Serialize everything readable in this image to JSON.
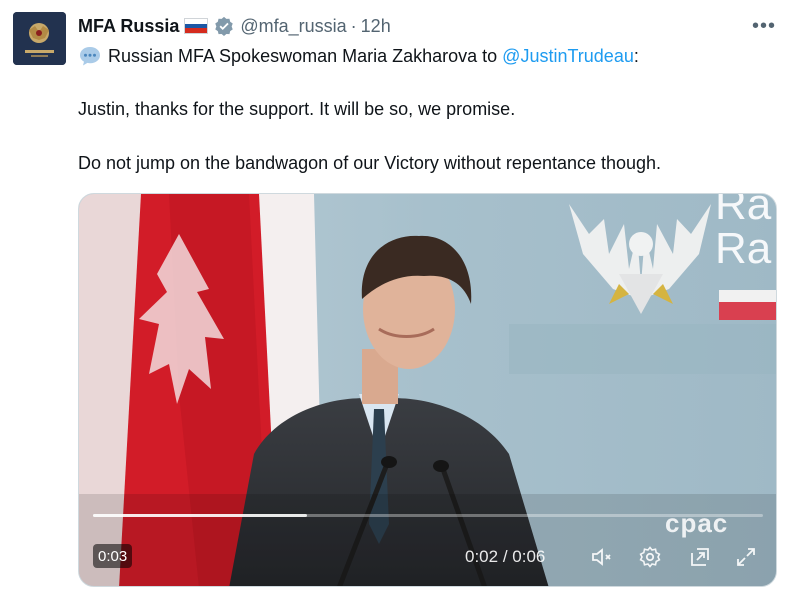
{
  "tweet": {
    "author": {
      "display_name": "MFA Russia",
      "handle": "@mfa_russia",
      "separator": "·",
      "time_ago": "12h",
      "flag_icon": "russia-flag-icon",
      "verified_icon": "verified-badge-icon",
      "verified_color": "#829aab"
    },
    "more_label": "•••",
    "line1": {
      "icon": "speech-bubble-icon",
      "text": "Russian MFA Spokeswoman Maria Zakharova to ",
      "mention": "@JustinTrudeau",
      "suffix": ":"
    },
    "paragraph1": "Justin, thanks for the support. It will be so, we promise.",
    "paragraph2": "Do not jump on the bandwagon of our Victory without repentance though.",
    "colors": {
      "link": "#1d9bf0",
      "text": "#0f1419",
      "secondary": "#536471"
    }
  },
  "video": {
    "elapsed_badge": "0:03",
    "current_time": "0:02",
    "time_separator": " / ",
    "duration": "0:06",
    "progress_fraction": 0.32,
    "watermark": "cpac",
    "sign_line1": "Ra",
    "sign_line2": "Ra",
    "controls": {
      "mute_icon": "muted-speaker-icon",
      "settings_icon": "settings-gear-icon",
      "popout_icon": "picture-in-picture-icon",
      "fullscreen_icon": "fullscreen-icon"
    }
  }
}
